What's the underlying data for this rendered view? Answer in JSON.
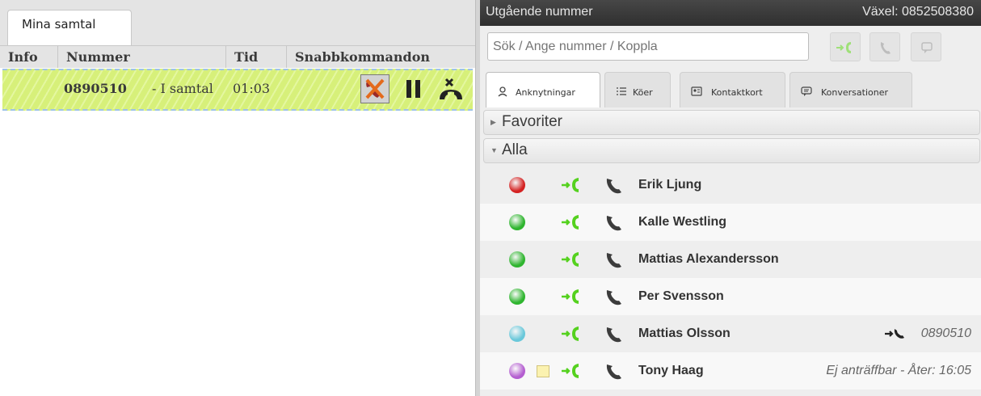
{
  "left_panel": {
    "tab_label": "Mina samtal",
    "columns": [
      "Info",
      "Nummer",
      "Tid",
      "Snabbkommandon"
    ],
    "active_call": {
      "number": "0890510",
      "state": "- I samtal",
      "duration": "01:03",
      "background_color": "#d7f07a"
    }
  },
  "right_panel": {
    "title": "Utgående nummer",
    "switchboard": "Växel: 0852508380",
    "search_placeholder": "Sök / Ange nummer / Koppla",
    "tabs": [
      {
        "label": "Anknytningar",
        "icon": "person-icon",
        "active": true
      },
      {
        "label": "Köer",
        "icon": "list-icon",
        "active": false
      },
      {
        "label": "Kontaktkort",
        "icon": "contact-card-icon",
        "active": false
      },
      {
        "label": "Konversationer",
        "icon": "chat-icon",
        "active": false
      }
    ],
    "sections": {
      "favorites": {
        "label": "Favoriter",
        "expanded": false
      },
      "all": {
        "label": "Alla",
        "expanded": true
      }
    },
    "contacts": [
      {
        "name": "Erik Ljung",
        "status_color": "#d42222",
        "extra": ""
      },
      {
        "name": "Kalle Westling",
        "status_color": "#2fb52f",
        "extra": ""
      },
      {
        "name": "Mattias Alexandersson",
        "status_color": "#2fb52f",
        "extra": ""
      },
      {
        "name": "Per Svensson",
        "status_color": "#2fb52f",
        "extra": ""
      },
      {
        "name": "Mattias Olsson",
        "status_color": "#6ac8da",
        "extra": "0890510",
        "in_call": true
      },
      {
        "name": "Tony Haag",
        "status_color": "#b45ed0",
        "extra": "Ej anträffbar - Åter: 16:05",
        "has_note": true
      }
    ],
    "colors": {
      "accent_green": "#55d11f",
      "phone_gray": "#3c3c3c",
      "title_bar": "#3a3a3a"
    }
  }
}
